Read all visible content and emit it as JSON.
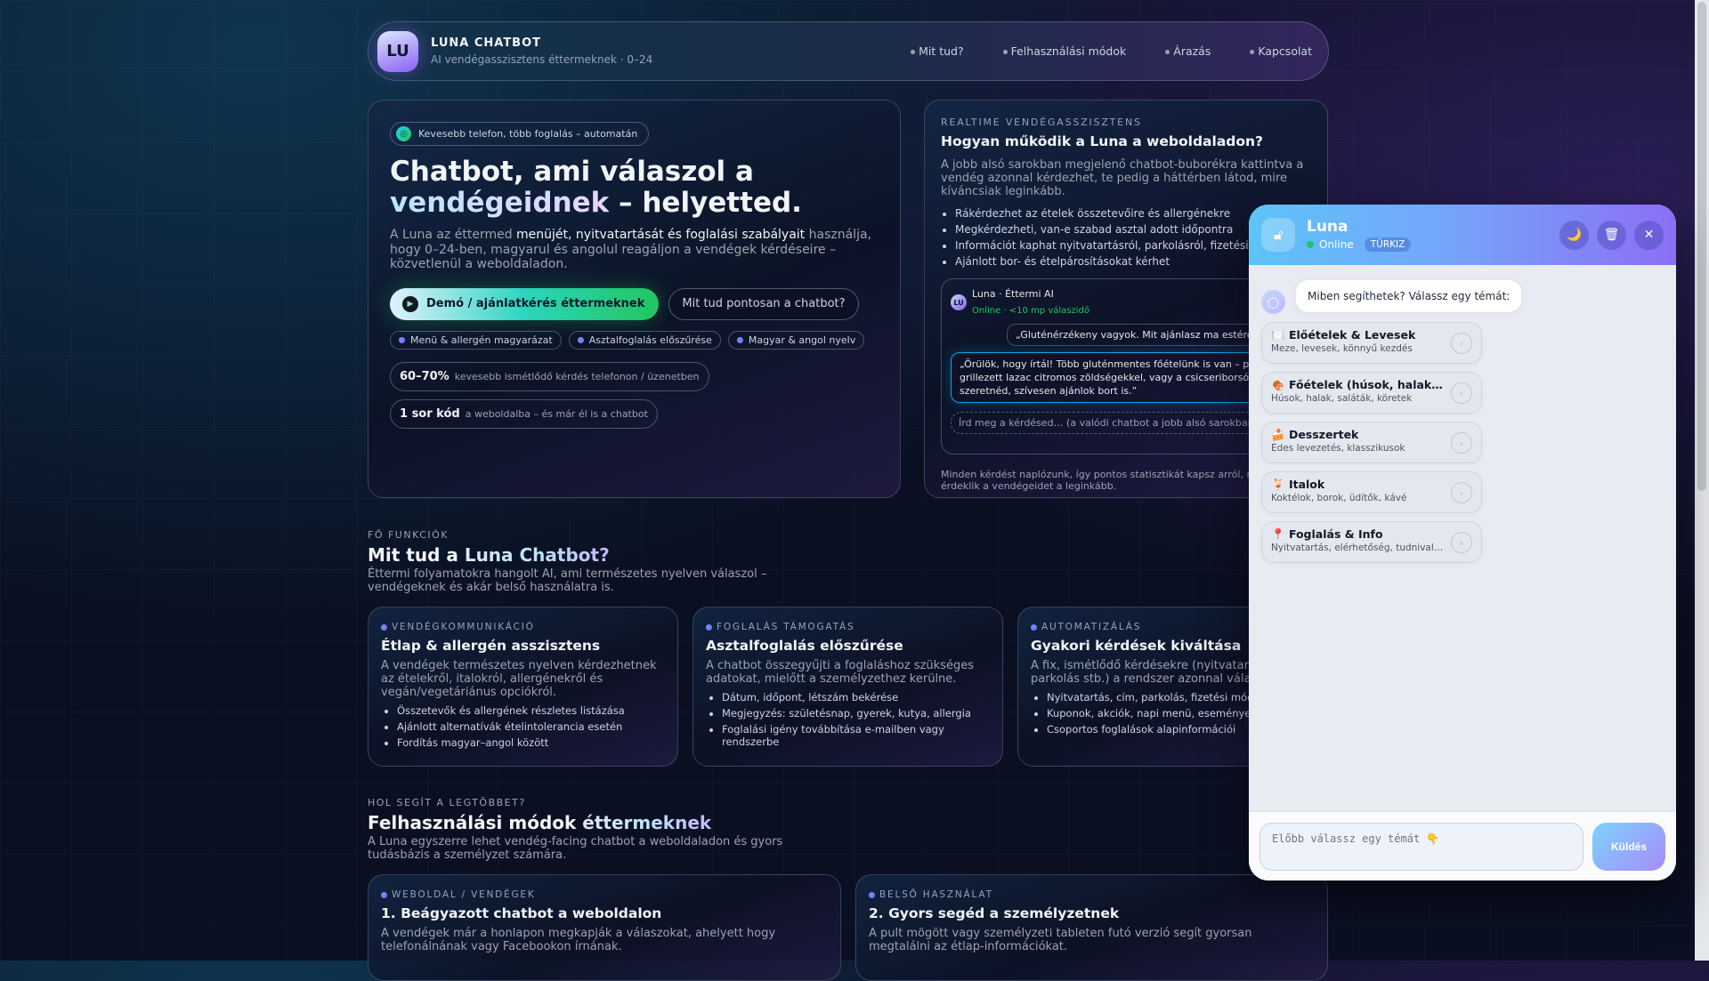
{
  "header": {
    "logo": "LU",
    "title": "LUNA CHATBOT",
    "subtitle": "AI vendégasszisztens éttermeknek · 0–24",
    "nav": [
      "Mit tud?",
      "Felhasználási módok",
      "Árazás",
      "Kapcsolat"
    ]
  },
  "hero": {
    "pill": "Kevesebb telefon, több foglalás – automatán",
    "title_1": "Chatbot, ami válaszol a",
    "title_highlight": "vendégeidnek",
    "title_2": " – helyetted.",
    "lead_1": "A Luna az éttermed ",
    "lead_bold": "menüjét, nyitvatartását és foglalási szabályait",
    "lead_2": " használja, hogy 0–24-ben, magyarul és angolul reagáljon a vendégek kérdéseire – közvetlenül a weboldaladon.",
    "primary_button": "Demó / ajánlatkérés éttermeknek",
    "secondary_button": "Mit tud pontosan a chatbot?",
    "tags": [
      "Menü & allergén magyarázat",
      "Asztalfoglalás előszűrése",
      "Magyar & angol nyelv"
    ],
    "stats": [
      {
        "value": "60–70%",
        "label": "kevesebb ismétlődő kérdés telefonon / üzenetben"
      },
      {
        "value": "1 sor kód",
        "label": "a weboldalba – és már él is a chatbot"
      }
    ]
  },
  "realtime": {
    "eyebrow": "REALTIME VENDÉGASSZISZTENS",
    "title": "Hogyan működik a Luna a weboldaladon?",
    "description": "A jobb alsó sarokban megjelenő chatbot-buborékra kattintva a vendég azonnal kérdezhet, te pedig a háttérben látod, mire kíváncsiak leginkább.",
    "bullets": [
      "Rákérdezhet az ételek összetevőire és allergénekre",
      "Megkérdezheti, van-e szabad asztal adott időpontra",
      "Információt kaphat nyitvatartásról, parkolásról, fizetési módokról",
      "Ajánlott bor- és ételpárosításokat kérhet"
    ],
    "preview": {
      "avatar": "LU",
      "name": "Luna · Éttermi AI",
      "status": "Online · <10 mp válaszidő",
      "user_message": "„Gluténérzékeny vagyok. Mit ajánlasz ma estére két főre?”",
      "bot_message_1": "„Örülök, hogy írtál! Több gluténmentes főételünk is van – például",
      "bot_message_2": "grillezett lazac citromos zöldségekkel, vagy a csicseriborsós tál. Ha",
      "bot_message_3": "szeretnéd, szívesen ajánlok bort is.”",
      "input_placeholder": "Írd meg a kérdésed… (a valódi chatbot a jobb alsó sarokban jelenik meg)"
    },
    "footer": "Minden kérdést naplózunk, így pontos statisztikát kapsz arról, mely témák érdeklik a vendégeidet a leginkább."
  },
  "features": {
    "label": "FŐ FUNKCIÓK",
    "title_1": "Mit tud a ",
    "title_highlight": "Luna Chatbot?",
    "description": "Éttermi folyamatokra hangolt AI, ami természetes nyelven válaszol – vendégeknek és akár belső használatra is.",
    "cards": [
      {
        "eyebrow": "VENDÉGKOMMUNIKÁCIÓ",
        "title": "Étlap & allergén asszisztens",
        "text": "A vendégek természetes nyelven kérdezhetnek az ételekről, italokról, allergénekről és vegán/vegetáriánus opciókról.",
        "bullets": [
          "Összetevők és allergének részletes listázása",
          "Ajánlott alternatívák ételintolerancia esetén",
          "Fordítás magyar–angol között"
        ]
      },
      {
        "eyebrow": "FOGLALÁS TÁMOGATÁS",
        "title": "Asztalfoglalás előszűrése",
        "text": "A chatbot összegyűjti a foglaláshoz szükséges adatokat, mielőtt a személyzethez kerülne.",
        "bullets": [
          "Dátum, időpont, létszám bekérése",
          "Megjegyzés: születésnap, gyerek, kutya, allergia",
          "Foglalási igény továbbítása e-mailben vagy rendszerbe"
        ]
      },
      {
        "eyebrow": "AUTOMATIZÁLÁS",
        "title": "Gyakori kérdések kiváltása",
        "text": "A fix, ismétlődő kérdésekre (nyitvatartás, parkolás stb.) a rendszer azonnal válaszol.",
        "bullets": [
          "Nyitvatartás, cím, parkolás, fizetési módok",
          "Kuponok, akciók, napi menü, események",
          "Csoportos foglalások alapinformációi"
        ]
      }
    ]
  },
  "usecases": {
    "label": "HOL SEGÍT A LEGTÖBBET?",
    "title_1": "Felhasználási módok ",
    "title_highlight": "éttermeknek",
    "description": "A Luna egyszerre lehet vendég-facing chatbot a weboldaladon és gyors tudásbázis a személyzet számára.",
    "cards": [
      {
        "eyebrow": "WEBOLDAL / VENDÉGEK",
        "title": "1. Beágyazott chatbot a weboldalon",
        "text": "A vendégek már a honlapon megkapják a válaszokat, ahelyett hogy telefonálnának vagy Facebookon írnának."
      },
      {
        "eyebrow": "BELSŐ HASZNÁLAT",
        "title": "2. Gyors segéd a személyzetnek",
        "text": "A pult mögött vagy személyzeti tableten futó verzió segít gyorsan megtalálni az étlap-információkat."
      }
    ]
  },
  "chat": {
    "name": "Luna",
    "status": "Online",
    "theme": "TÜRKIZ",
    "greeting": "Miben segíthetek? Válassz egy témát:",
    "topics": [
      {
        "icon": "🍽️",
        "title": "Előételek & Levesek",
        "subtitle": "Meze, levesek, könnyű kezdés"
      },
      {
        "icon": "🍖",
        "title": "Főételek (húsok, halak, saláták)",
        "subtitle": "Húsok, halak, saláták, köretek"
      },
      {
        "icon": "🍰",
        "title": "Desszertek",
        "subtitle": "Édes levezetés, klasszikusok"
      },
      {
        "icon": "🍹",
        "title": "Italok",
        "subtitle": "Koktélok, borok, üdítők, kávé"
      },
      {
        "icon": "📍",
        "title": "Foglalás & Info",
        "subtitle": "Nyitvatartás, elérhetőség, tudnivalók"
      }
    ],
    "input_placeholder": "Előbb válassz egy témát 👇",
    "send_label": "Küldés"
  }
}
